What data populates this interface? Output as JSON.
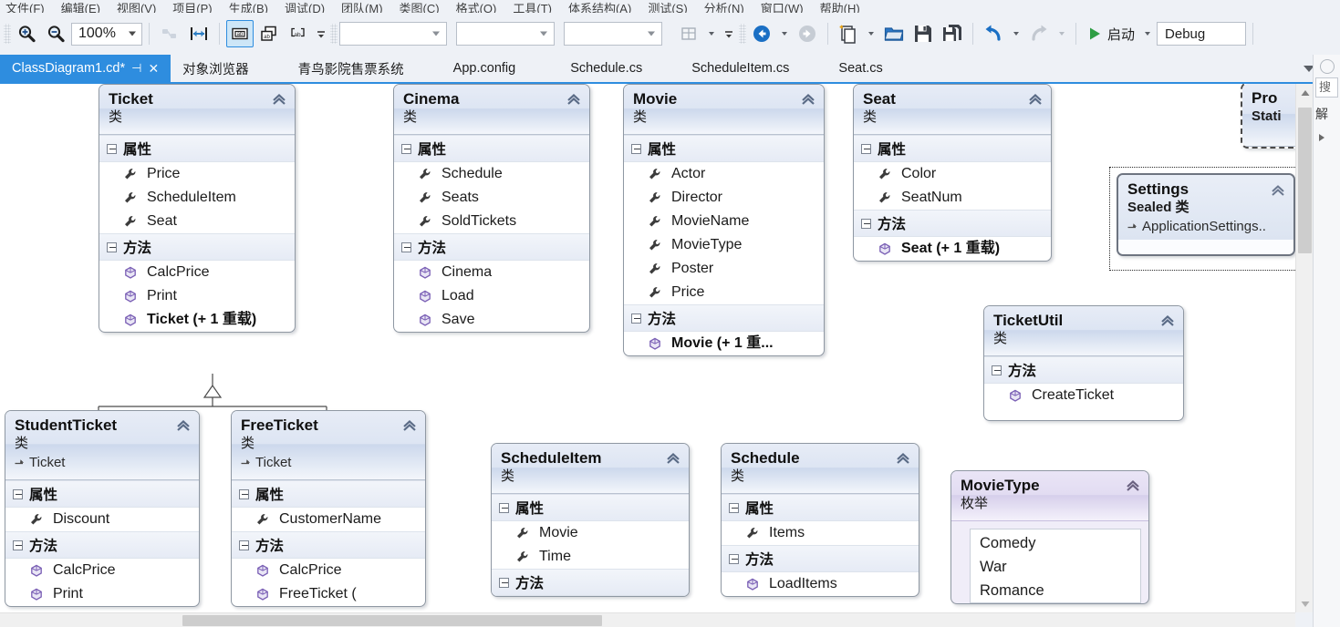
{
  "menubar": {
    "items": [
      "文件(F)",
      "编辑(E)",
      "视图(V)",
      "项目(P)",
      "生成(B)",
      "调试(D)",
      "团队(M)",
      "类图(C)",
      "格式(O)",
      "工具(T)",
      "体系结构(A)",
      "测试(S)",
      "分析(N)",
      "窗口(W)",
      "帮助(H)"
    ]
  },
  "toolbar": {
    "zoom_in": "zoom-in",
    "zoom_out": "zoom-out",
    "zoom_value": "100%",
    "align_label": "align",
    "width_label": "fit-width",
    "display_name_label": "display-name",
    "display_full_label": "display-full",
    "display_partial_label": "display-partial",
    "combo1": "",
    "combo2": "",
    "combo3": "",
    "layout_label": "layout",
    "nav_back": "navigate-back",
    "nav_forward": "navigate-forward",
    "new_item": "new-item",
    "open": "open",
    "save": "save",
    "save_all": "save-all",
    "undo": "undo",
    "redo": "redo",
    "run_label": "启动",
    "config_value": "Debug"
  },
  "tabs": {
    "items": [
      {
        "label": "ClassDiagram1.cd*",
        "active": true,
        "closable": true
      },
      {
        "label": "对象浏览器",
        "active": false,
        "closable": false
      },
      {
        "label": "青鸟影院售票系统",
        "active": false,
        "closable": false
      },
      {
        "label": "App.config",
        "active": false,
        "closable": false
      },
      {
        "label": "Schedule.cs",
        "active": false,
        "closable": false
      },
      {
        "label": "ScheduleItem.cs",
        "active": false,
        "closable": false
      },
      {
        "label": "Seat.cs",
        "active": false,
        "closable": false
      }
    ],
    "overflow_label": "解"
  },
  "right_panel": {
    "search_placeholder": "搜",
    "label_row": "解"
  },
  "diagram": {
    "group_properties": "属性",
    "group_methods": "方法",
    "shapes": [
      {
        "name": "Ticket",
        "stereotype": "类",
        "properties": [
          "Price",
          "ScheduleItem",
          "Seat"
        ],
        "methods": [
          "CalcPrice",
          "Print",
          "Ticket (+ 1 重载)"
        ],
        "bold_methods": [
          "Ticket (+ 1 重载)"
        ]
      },
      {
        "name": "Cinema",
        "stereotype": "类",
        "properties": [
          "Schedule",
          "Seats",
          "SoldTickets"
        ],
        "methods": [
          "Cinema",
          "Load",
          "Save"
        ],
        "bold_methods": []
      },
      {
        "name": "Movie",
        "stereotype": "类",
        "properties": [
          "Actor",
          "Director",
          "MovieName",
          "MovieType",
          "Poster",
          "Price"
        ],
        "methods": [
          "Movie (+ 1 重..."
        ],
        "bold_methods": [
          "Movie (+ 1 重..."
        ]
      },
      {
        "name": "Seat",
        "stereotype": "类",
        "properties": [
          "Color",
          "SeatNum"
        ],
        "methods": [
          "Seat (+ 1 重载)"
        ],
        "bold_methods": [
          "Seat (+ 1 重载)"
        ]
      },
      {
        "name": "TicketUtil",
        "stereotype": "类",
        "properties": [],
        "methods": [
          "CreateTicket"
        ],
        "bold_methods": []
      },
      {
        "name": "StudentTicket",
        "stereotype": "类",
        "base": "Ticket",
        "properties": [
          "Discount"
        ],
        "methods": [
          "CalcPrice",
          "Print"
        ],
        "bold_methods": []
      },
      {
        "name": "FreeTicket",
        "stereotype": "类",
        "base": "Ticket",
        "properties": [
          "CustomerName"
        ],
        "methods": [
          "CalcPrice",
          "FreeTicket ("
        ],
        "bold_methods": []
      },
      {
        "name": "ScheduleItem",
        "stereotype": "类",
        "properties": [
          "Movie",
          "Time"
        ],
        "methods": [],
        "bold_methods": []
      },
      {
        "name": "Schedule",
        "stereotype": "类",
        "properties": [
          "Items"
        ],
        "methods": [
          "LoadItems"
        ],
        "bold_methods": []
      },
      {
        "name": "MovieType",
        "stereotype": "枚举",
        "enum_values": [
          "Comedy",
          "War",
          "Romance"
        ]
      },
      {
        "name": "Settings",
        "stereotype": "Sealed 类",
        "base": "ApplicationSettings..",
        "selected": true
      },
      {
        "name": "Pro",
        "stereotype": "Stati",
        "clipped": true
      }
    ]
  }
}
